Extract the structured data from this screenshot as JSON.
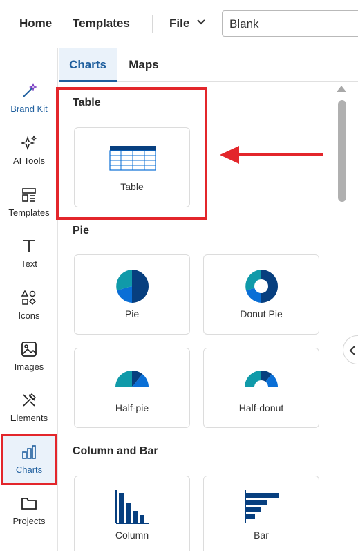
{
  "topnav": {
    "home": "Home",
    "templates": "Templates",
    "file": "File",
    "doc_name": "Blank"
  },
  "sidebar": {
    "items": [
      {
        "label": "Brand Kit",
        "icon": "magic-wand-icon"
      },
      {
        "label": "AI Tools",
        "icon": "sparkles-icon"
      },
      {
        "label": "Templates",
        "icon": "templates-icon"
      },
      {
        "label": "Text",
        "icon": "text-icon"
      },
      {
        "label": "Icons",
        "icon": "shapes-icon"
      },
      {
        "label": "Images",
        "icon": "image-icon"
      },
      {
        "label": "Elements",
        "icon": "elements-icon"
      },
      {
        "label": "Charts",
        "icon": "bar-chart-icon"
      },
      {
        "label": "Projects",
        "icon": "folder-icon"
      }
    ]
  },
  "tabs": {
    "charts": "Charts",
    "maps": "Maps"
  },
  "sections": {
    "table": {
      "title": "Table",
      "cards": [
        {
          "label": "Table"
        }
      ]
    },
    "pie": {
      "title": "Pie",
      "cards": [
        {
          "label": "Pie"
        },
        {
          "label": "Donut Pie"
        },
        {
          "label": "Half-pie"
        },
        {
          "label": "Half-donut"
        }
      ]
    },
    "column_bar": {
      "title": "Column and Bar",
      "cards": [
        {
          "label": "Column"
        },
        {
          "label": "Bar"
        }
      ]
    }
  },
  "colors": {
    "accent": "#1f5f9e",
    "navy": "#073f7f",
    "teal": "#109aa9",
    "blue": "#0a6fd6",
    "highlight": "#e3262b"
  }
}
